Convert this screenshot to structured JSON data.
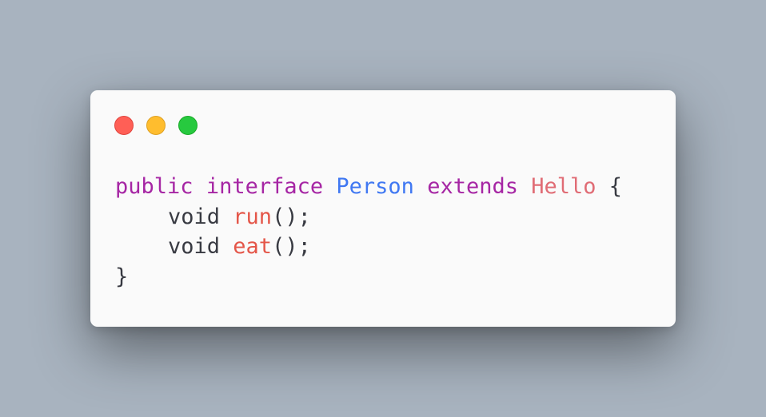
{
  "window": {
    "controls": [
      {
        "name": "close",
        "color": "#ff5f56"
      },
      {
        "name": "minimize",
        "color": "#ffbd2e"
      },
      {
        "name": "maximize",
        "color": "#27c93f"
      }
    ]
  },
  "code": {
    "colors": {
      "keyword": "#a626a4",
      "type_name": "#4078f2",
      "method_name": "#e45649",
      "supertype": "#e06c75",
      "plain": "#383a42"
    },
    "lines": [
      {
        "tokens": [
          {
            "text": "public",
            "kind": "keyword"
          },
          {
            "text": " ",
            "kind": "plain"
          },
          {
            "text": "interface",
            "kind": "keyword"
          },
          {
            "text": " ",
            "kind": "plain"
          },
          {
            "text": "Person",
            "kind": "type_name"
          },
          {
            "text": " ",
            "kind": "plain"
          },
          {
            "text": "extends",
            "kind": "keyword"
          },
          {
            "text": " ",
            "kind": "plain"
          },
          {
            "text": "Hello",
            "kind": "supertype"
          },
          {
            "text": " {",
            "kind": "plain"
          }
        ]
      },
      {
        "indent": true,
        "tokens": [
          {
            "text": "void",
            "kind": "plain"
          },
          {
            "text": " ",
            "kind": "plain"
          },
          {
            "text": "run",
            "kind": "method_name"
          },
          {
            "text": "();",
            "kind": "plain"
          }
        ]
      },
      {
        "indent": true,
        "tokens": [
          {
            "text": "void",
            "kind": "plain"
          },
          {
            "text": " ",
            "kind": "plain"
          },
          {
            "text": "eat",
            "kind": "method_name"
          },
          {
            "text": "();",
            "kind": "plain"
          }
        ]
      },
      {
        "tokens": [
          {
            "text": "}",
            "kind": "plain"
          }
        ]
      }
    ]
  }
}
